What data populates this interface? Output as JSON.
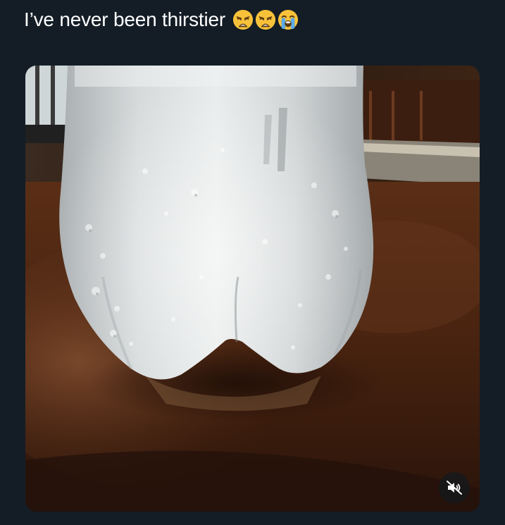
{
  "tweet": {
    "text": "I’ve never been thirstier",
    "emojis": [
      "weary-face-emoji",
      "weary-face-emoji",
      "loudly-crying-face-emoji"
    ]
  },
  "media": {
    "type": "video",
    "muted": true,
    "mute_icon": "speaker-muted-icon"
  },
  "colors": {
    "background": "#141d26",
    "text": "#ffffff",
    "emoji_yellow": "#f7c23a",
    "tears_blue": "#5aa9e6"
  }
}
